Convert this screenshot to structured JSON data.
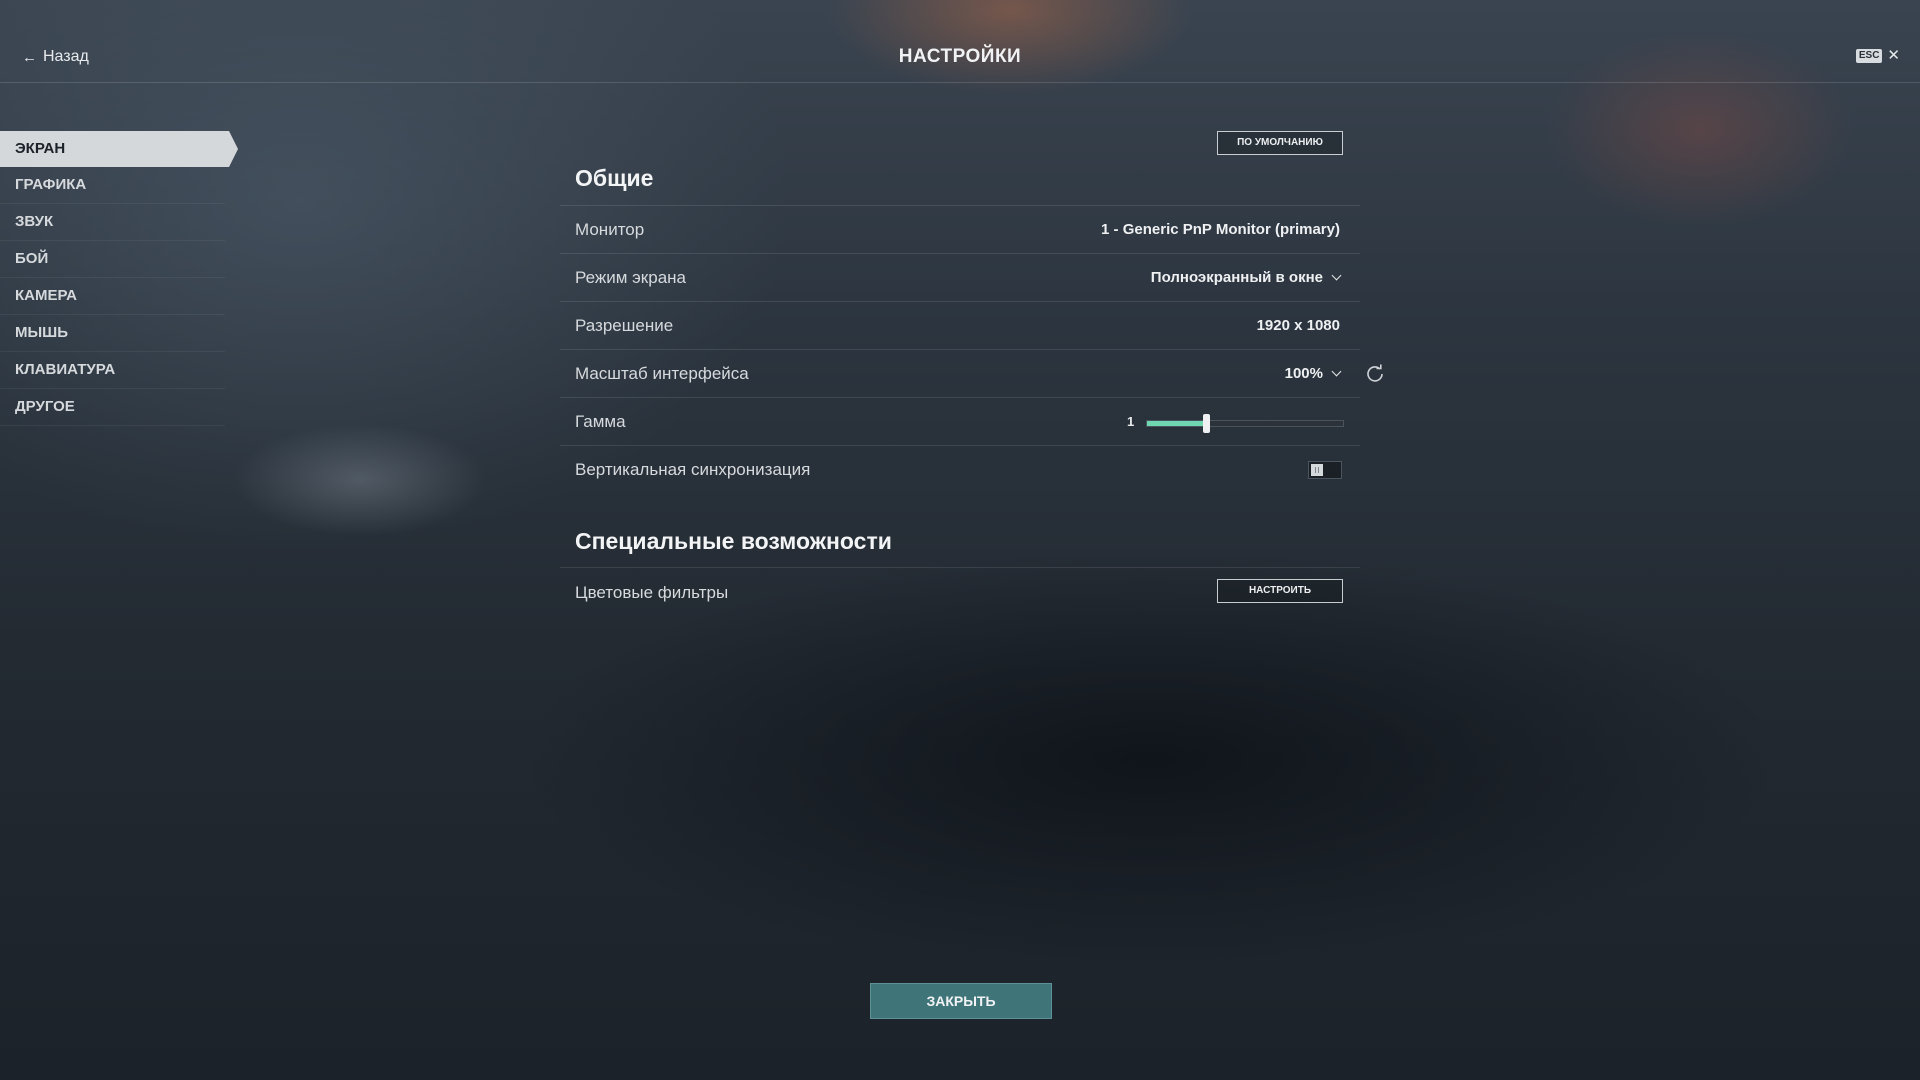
{
  "header": {
    "back_label": "Назад",
    "title": "НАСТРОЙКИ",
    "esc_label": "ESC"
  },
  "sidebar": {
    "items": [
      {
        "label": "ЭКРАН",
        "active": true
      },
      {
        "label": "ГРАФИКА",
        "active": false
      },
      {
        "label": "ЗВУК",
        "active": false
      },
      {
        "label": "БОЙ",
        "active": false
      },
      {
        "label": "КАМЕРА",
        "active": false
      },
      {
        "label": "МЫШЬ",
        "active": false
      },
      {
        "label": "КЛАВИАТУРА",
        "active": false
      },
      {
        "label": "ДРУГОЕ",
        "active": false
      }
    ]
  },
  "main": {
    "default_button": "ПО УМОЛЧАНИЮ",
    "general": {
      "title": "Общие",
      "monitor": {
        "label": "Монитор",
        "value": "1 - Generic PnP Monitor (primary)"
      },
      "screen_mode": {
        "label": "Режим экрана",
        "value": "Полноэкранный в окне"
      },
      "resolution": {
        "label": "Разрешение",
        "value": "1920 x 1080"
      },
      "ui_scale": {
        "label": "Масштаб интерфейса",
        "value": "100%"
      },
      "gamma": {
        "label": "Гамма",
        "value": "1",
        "slider_fraction": 0.3
      },
      "vsync": {
        "label": "Вертикальная синхронизация",
        "enabled": false
      }
    },
    "accessibility": {
      "title": "Специальные возможности",
      "color_filters": {
        "label": "Цветовые фильтры",
        "button": "НАСТРОИТЬ"
      }
    },
    "close_button": "ЗАКРЫТЬ"
  },
  "colors": {
    "accent": "#6fd8b1",
    "close_button_bg": "#3f7479",
    "active_tab_bg": "#d5d8db"
  }
}
